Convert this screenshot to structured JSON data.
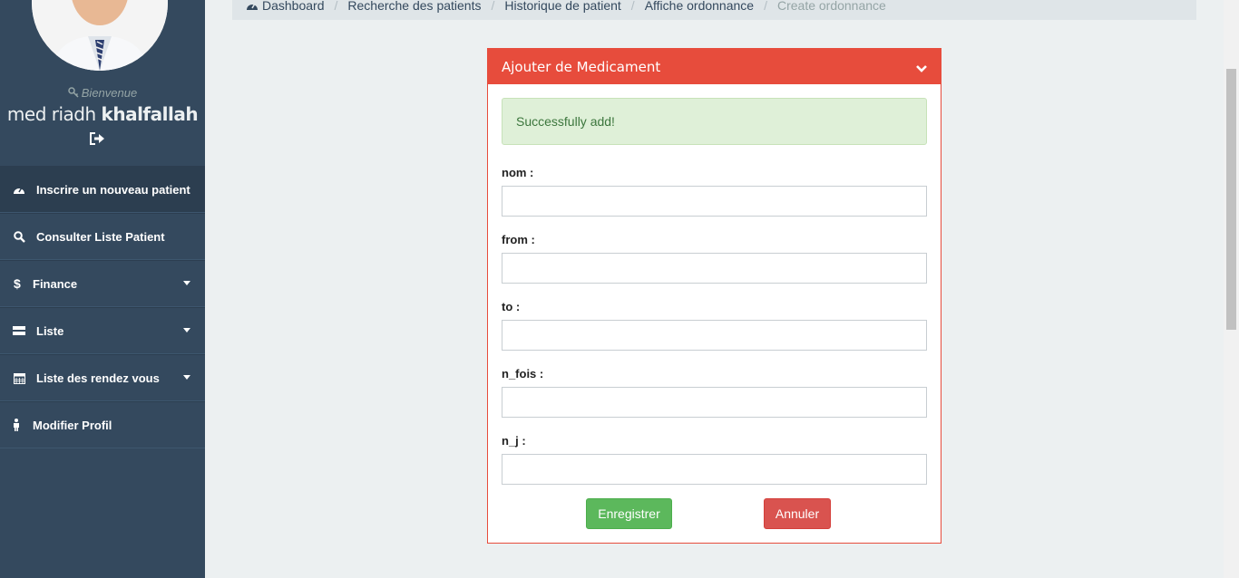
{
  "sidebar": {
    "welcome": "Bienvenue",
    "user_first": "med riadh",
    "user_last": "khalfallah",
    "items": [
      {
        "label": "Inscrire un nouveau patient",
        "icon": "dashboard-icon"
      },
      {
        "label": "Consulter Liste Patient",
        "icon": "search-icon"
      },
      {
        "label": "Finance",
        "icon": "dollar-icon"
      },
      {
        "label": "Liste",
        "icon": "list-icon"
      },
      {
        "label": "Liste des rendez vous",
        "icon": "calendar-icon"
      },
      {
        "label": "Modifier Profil",
        "icon": "person-icon"
      }
    ]
  },
  "breadcrumb": {
    "items": [
      "Dashboard",
      "Recherche des patients",
      "Historique de patient",
      "Affiche ordonnance"
    ],
    "current": "Create ordonnance"
  },
  "panel": {
    "title": "Ajouter de Medicament",
    "alert": "Successfully add!",
    "fields": [
      {
        "label": "nom :",
        "value": ""
      },
      {
        "label": "from :",
        "value": ""
      },
      {
        "label": "to :",
        "value": ""
      },
      {
        "label": "n_fois :",
        "value": ""
      },
      {
        "label": "n_j :",
        "value": ""
      }
    ],
    "save_label": "Enregistrer",
    "cancel_label": "Annuler"
  },
  "colors": {
    "sidebar": "#34495e",
    "panel_header": "#e74c3c",
    "success": "#5cb85c",
    "danger": "#d9534f"
  }
}
